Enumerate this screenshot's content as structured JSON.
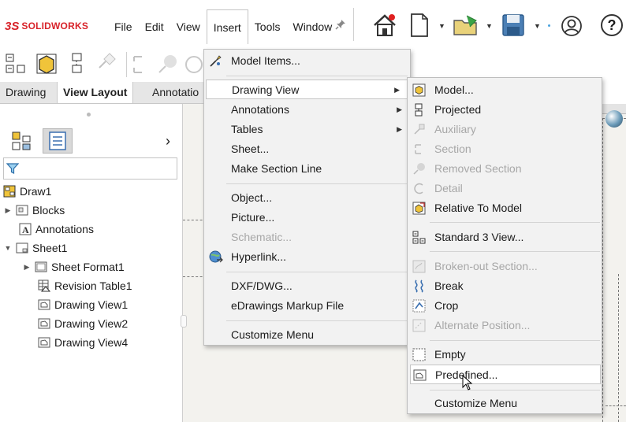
{
  "app": {
    "logo_ds": "3S",
    "logo_text": "SOLIDWORKS"
  },
  "menubar": [
    {
      "label": "File"
    },
    {
      "label": "Edit"
    },
    {
      "label": "View"
    },
    {
      "label": "Insert"
    },
    {
      "label": "Tools"
    },
    {
      "label": "Window"
    }
  ],
  "toolbar": {
    "icons": [
      "home-icon",
      "new-document-icon",
      "open-icon",
      "save-icon",
      "account-icon",
      "help-icon"
    ],
    "help_label": "?"
  },
  "command_tabs": [
    {
      "label": "Drawing"
    },
    {
      "label": "View Layout"
    },
    {
      "label": "Annotatio"
    }
  ],
  "panel": {
    "expand_glyph": "›",
    "tree": [
      {
        "label": "Draw1",
        "icon": "drawing-icon"
      },
      {
        "label": "Blocks",
        "icon": "blocks-icon"
      },
      {
        "label": "Annotations",
        "icon": "annotations-icon"
      },
      {
        "label": "Sheet1",
        "icon": "sheet-icon"
      },
      {
        "label": "Sheet Format1",
        "icon": "sheet-format-icon"
      },
      {
        "label": "Revision Table1",
        "icon": "revision-table-icon"
      },
      {
        "label": "Drawing View1",
        "icon": "drawing-view-icon"
      },
      {
        "label": "Drawing View2",
        "icon": "drawing-view-icon"
      },
      {
        "label": "Drawing View4",
        "icon": "drawing-view-icon"
      }
    ]
  },
  "insert_menu": {
    "items": [
      {
        "label": "Model Items...",
        "icon": "model-items-icon"
      },
      {
        "label": "Drawing View",
        "submenu": true
      },
      {
        "label": "Annotations",
        "submenu": true
      },
      {
        "label": "Tables",
        "submenu": true
      },
      {
        "label": "Sheet..."
      },
      {
        "label": "Make Section Line"
      },
      {
        "label": "Object..."
      },
      {
        "label": "Picture..."
      },
      {
        "label": "Schematic...",
        "disabled": true
      },
      {
        "label": "Hyperlink...",
        "icon": "hyperlink-icon"
      },
      {
        "label": "DXF/DWG..."
      },
      {
        "label": "eDrawings Markup File"
      },
      {
        "label": "Customize Menu"
      }
    ]
  },
  "drawing_view_menu": {
    "items": [
      {
        "label": "Model...",
        "icon": "model-view-icon"
      },
      {
        "label": "Projected",
        "icon": "projected-view-icon"
      },
      {
        "label": "Auxiliary",
        "icon": "auxiliary-view-icon",
        "disabled": true
      },
      {
        "label": "Section",
        "icon": "section-view-icon",
        "disabled": true
      },
      {
        "label": "Removed Section",
        "icon": "removed-section-icon",
        "disabled": true
      },
      {
        "label": "Detail",
        "icon": "detail-view-icon",
        "disabled": true
      },
      {
        "label": "Relative To Model",
        "icon": "relative-to-model-icon"
      },
      {
        "label": "Standard 3 View...",
        "icon": "standard-3-view-icon"
      },
      {
        "label": "Broken-out Section...",
        "icon": "broken-out-section-icon",
        "disabled": true
      },
      {
        "label": "Break",
        "icon": "break-icon"
      },
      {
        "label": "Crop",
        "icon": "crop-icon"
      },
      {
        "label": "Alternate Position...",
        "icon": "alternate-position-icon",
        "disabled": true
      },
      {
        "label": "Empty",
        "icon": "empty-view-icon"
      },
      {
        "label": "Predefined...",
        "icon": "predefined-view-icon"
      },
      {
        "label": "Customize Menu"
      }
    ]
  },
  "colors": {
    "brand": "#d8232a",
    "menu_bg": "#f2f2f2",
    "disabled_text": "#a7a7a7"
  }
}
